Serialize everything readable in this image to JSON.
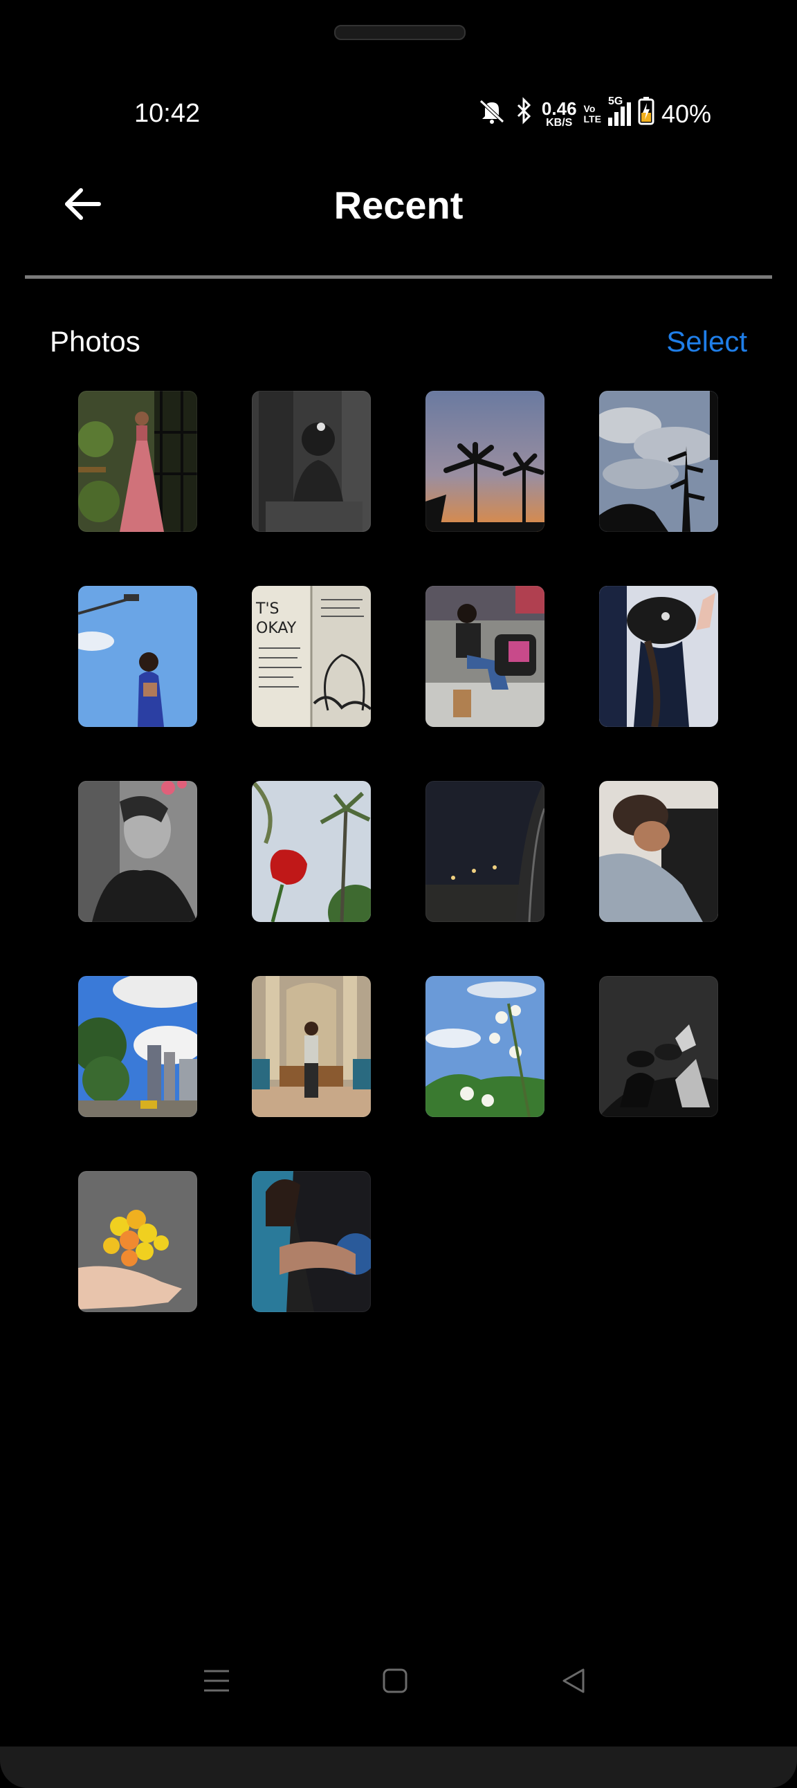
{
  "status_bar": {
    "time": "10:42",
    "net_speed_value": "0.46",
    "net_speed_unit": "KB/S",
    "volte_top": "Vo",
    "volte_bottom": "LTE",
    "network": "5G",
    "battery": "40%",
    "icons": [
      "mute-icon",
      "bluetooth-icon",
      "signal-icon",
      "battery-charging-icon"
    ]
  },
  "header": {
    "title": "Recent",
    "back_icon": "arrow-left-icon"
  },
  "section": {
    "label": "Photos",
    "select_label": "Select",
    "accent_color": "#1f7ee8"
  },
  "photos": [
    {
      "subject": "woman-pink-dress"
    },
    {
      "subject": "mirror-selfie-grayscale"
    },
    {
      "subject": "palm-trees-sunset"
    },
    {
      "subject": "cloudy-sky-plants"
    },
    {
      "subject": "woman-blue-sky"
    },
    {
      "subject": "sketchbook-its-okay"
    },
    {
      "subject": "woman-sitting-mall"
    },
    {
      "subject": "cap-from-above"
    },
    {
      "subject": "grayscale-selfie"
    },
    {
      "subject": "red-rose-palms"
    },
    {
      "subject": "night-car-window"
    },
    {
      "subject": "friends-hugging"
    },
    {
      "subject": "city-street-clouds"
    },
    {
      "subject": "woman-lobby-bench"
    },
    {
      "subject": "white-flowers-sky"
    },
    {
      "subject": "shoes-grayscale"
    },
    {
      "subject": "yellow-flowers-hand"
    },
    {
      "subject": "hug-blue-shirt"
    }
  ],
  "nav_bar": {
    "icons": [
      "menu-icon",
      "home-square-icon",
      "back-triangle-icon"
    ]
  }
}
